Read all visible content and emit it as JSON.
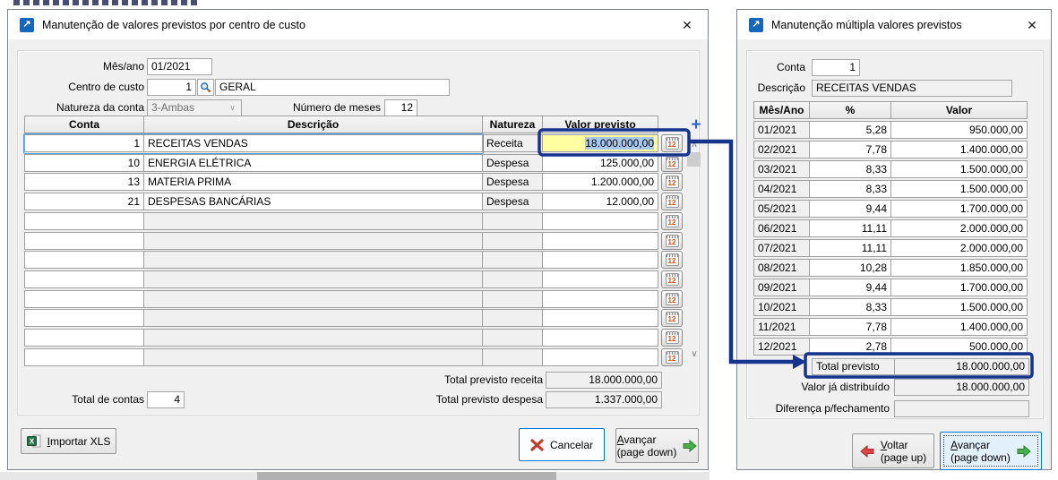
{
  "left_window": {
    "title": "Manutenção de valores previstos por centro de custo",
    "fields": {
      "mes_ano_label": "Mês/ano",
      "mes_ano_value": "01/2021",
      "centro_custo_label": "Centro de custo",
      "centro_custo_code": "1",
      "centro_custo_name": "GERAL",
      "natureza_label": "Natureza da conta",
      "natureza_value": "3-Ambas",
      "num_meses_label": "Número de meses",
      "num_meses_value": "12"
    },
    "table": {
      "headers": [
        "Conta",
        "Descrição",
        "Natureza",
        "Valor previsto"
      ],
      "rows": [
        {
          "conta": "1",
          "descricao": "RECEITAS VENDAS",
          "natureza": "Receita",
          "valor": "18.000.000,00"
        },
        {
          "conta": "10",
          "descricao": "ENERGIA ELÉTRICA",
          "natureza": "Despesa",
          "valor": "125.000,00"
        },
        {
          "conta": "13",
          "descricao": "MATERIA PRIMA",
          "natureza": "Despesa",
          "valor": "1.200.000,00"
        },
        {
          "conta": "21",
          "descricao": "DESPESAS BANCÁRIAS",
          "natureza": "Despesa",
          "valor": "12.000,00"
        }
      ]
    },
    "totals": {
      "receita_label": "Total previsto receita",
      "receita_value": "18.000.000,00",
      "despesa_label": "Total previsto despesa",
      "despesa_value": "1.337.000,00",
      "contas_label": "Total de contas",
      "contas_value": "4"
    },
    "buttons": {
      "importar": "Importar XLS",
      "cancelar": "Cancelar",
      "avancar_line1": "Avançar",
      "avancar_line2": "(page down)"
    }
  },
  "right_window": {
    "title": "Manutenção múltipla valores previstos",
    "fields": {
      "conta_label": "Conta",
      "conta_value": "1",
      "descricao_label": "Descrição",
      "descricao_value": "RECEITAS VENDAS"
    },
    "table": {
      "headers": [
        "Mês/Ano",
        "%",
        "Valor"
      ],
      "rows": [
        {
          "mes": "01/2021",
          "pct": "5,28",
          "valor": "950.000,00"
        },
        {
          "mes": "02/2021",
          "pct": "7,78",
          "valor": "1.400.000,00"
        },
        {
          "mes": "03/2021",
          "pct": "8,33",
          "valor": "1.500.000,00"
        },
        {
          "mes": "04/2021",
          "pct": "8,33",
          "valor": "1.500.000,00"
        },
        {
          "mes": "05/2021",
          "pct": "9,44",
          "valor": "1.700.000,00"
        },
        {
          "mes": "06/2021",
          "pct": "11,11",
          "valor": "2.000.000,00"
        },
        {
          "mes": "07/2021",
          "pct": "11,11",
          "valor": "2.000.000,00"
        },
        {
          "mes": "08/2021",
          "pct": "10,28",
          "valor": "1.850.000,00"
        },
        {
          "mes": "09/2021",
          "pct": "9,44",
          "valor": "1.700.000,00"
        },
        {
          "mes": "10/2021",
          "pct": "8,33",
          "valor": "1.500.000,00"
        },
        {
          "mes": "11/2021",
          "pct": "7,78",
          "valor": "1.400.000,00"
        },
        {
          "mes": "12/2021",
          "pct": "2,78",
          "valor": "500.000,00"
        }
      ]
    },
    "totals": {
      "total_previsto_label": "Total previsto",
      "total_previsto_value": "18.000.000,00",
      "distribuido_label": "Valor já distribuído",
      "distribuido_value": "18.000.000,00",
      "diferenca_label": "Diferença p/fechamento",
      "diferenca_value": ""
    },
    "buttons": {
      "voltar_line1": "Voltar",
      "voltar_line2": "(page up)",
      "avancar_line1": "Avançar",
      "avancar_line2": "(page down)"
    }
  },
  "icons": {
    "window_glyph": "↗",
    "close_glyph": "✕",
    "calendar_glyph": "12",
    "plus_glyph": "+",
    "scroll_up_glyph": "∧",
    "scroll_down_glyph": "∨",
    "dropdown_glyph": "∨"
  },
  "colors": {
    "annotation_navy": "#16338e",
    "selected_cell_yellow": "#ffffa0",
    "focus_blue": "#0078d7"
  }
}
